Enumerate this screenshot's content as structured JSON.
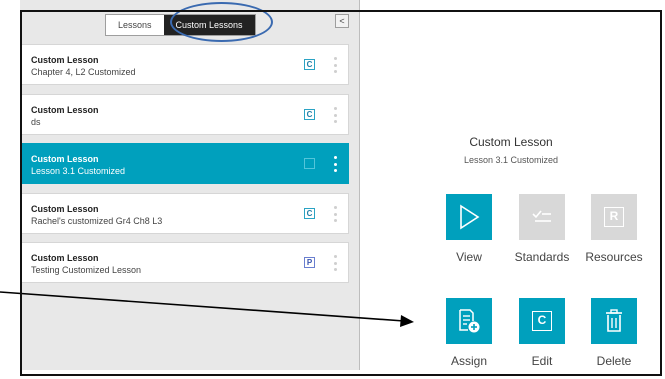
{
  "tabs": [
    {
      "label": "Lessons",
      "active": false
    },
    {
      "label": "Custom Lessons",
      "active": true
    }
  ],
  "collapse_glyph": "<",
  "lessons": [
    {
      "title": "Custom Lesson",
      "subtitle": "Chapter 4, L2 Customized",
      "badge": "C",
      "selected": false
    },
    {
      "title": "Custom Lesson",
      "subtitle": "ds",
      "badge": "C",
      "selected": false
    },
    {
      "title": "Custom Lesson",
      "subtitle": "Lesson 3.1 Customized",
      "badge": "C",
      "selected": true
    },
    {
      "title": "Custom Lesson",
      "subtitle": "Rachel's customized Gr4 Ch8 L3",
      "badge": "C",
      "selected": false
    },
    {
      "title": "Custom Lesson",
      "subtitle": "Testing Customized Lesson",
      "badge": "P",
      "selected": false
    }
  ],
  "detail": {
    "title": "Custom Lesson",
    "subtitle": "Lesson 3.1 Customized"
  },
  "actions": {
    "view": {
      "label": "View",
      "icon": "play-triangle-icon",
      "enabled": true
    },
    "standards": {
      "label": "Standards",
      "icon": "checklist-icon",
      "enabled": false
    },
    "resources": {
      "label": "Resources",
      "icon": "resources-r-icon",
      "icon_text": "R",
      "enabled": false
    },
    "assign": {
      "label": "Assign",
      "icon": "assign-document-plus-icon",
      "enabled": true
    },
    "edit": {
      "label": "Edit",
      "icon": "edit-c-icon",
      "icon_text": "C",
      "enabled": true
    },
    "delete": {
      "label": "Delete",
      "icon": "trash-icon",
      "enabled": true
    }
  },
  "colors": {
    "accent": "#00a0bd",
    "disabled_tile": "#d8d8d8",
    "highlight_circle": "#3a6ab0"
  }
}
